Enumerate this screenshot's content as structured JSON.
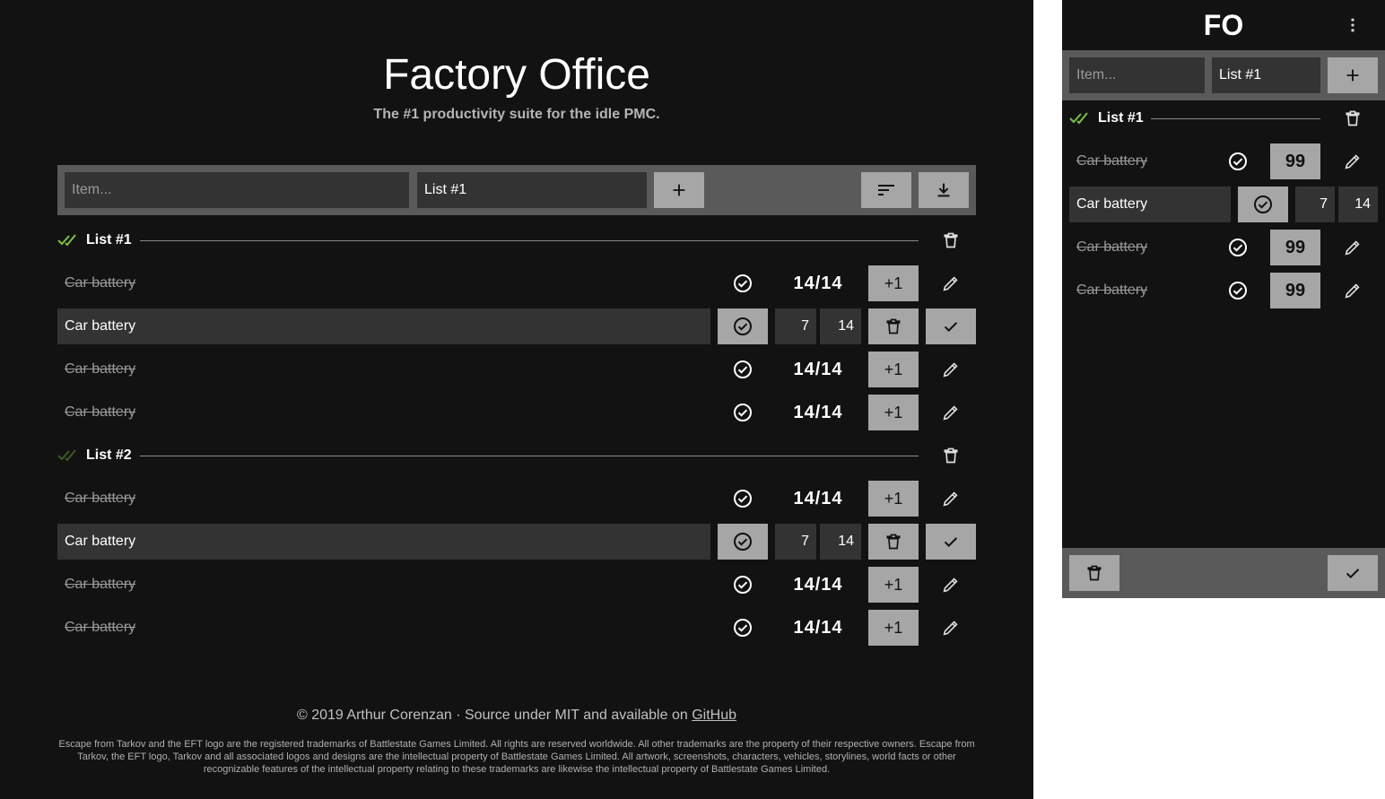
{
  "app": {
    "title": "Factory Office",
    "subtitle": "The #1 productivity suite for the idle PMC.",
    "short_title": "FO"
  },
  "toolbar": {
    "item_placeholder": "Item...",
    "list_value": "List #1",
    "add_icon": "plus-icon",
    "sort_icon": "sort-icon",
    "download_icon": "download-icon"
  },
  "lists": [
    {
      "name": "List #1",
      "status_icon": "double-check-icon",
      "status_color": "#7cc043",
      "items": [
        {
          "label": "Car battery",
          "mode": "view",
          "count": "14/14",
          "action": "+1"
        },
        {
          "label": "Car battery",
          "mode": "edit",
          "have": "7",
          "need": "14"
        },
        {
          "label": "Car battery",
          "mode": "view",
          "count": "14/14",
          "action": "+1"
        },
        {
          "label": "Car battery",
          "mode": "view",
          "count": "14/14",
          "action": "+1"
        }
      ]
    },
    {
      "name": "List #2",
      "status_icon": "double-check-icon",
      "status_color": "#3d5a25",
      "items": [
        {
          "label": "Car battery",
          "mode": "view",
          "count": "14/14",
          "action": "+1"
        },
        {
          "label": "Car battery",
          "mode": "edit",
          "have": "7",
          "need": "14"
        },
        {
          "label": "Car battery",
          "mode": "view",
          "count": "14/14",
          "action": "+1"
        },
        {
          "label": "Car battery",
          "mode": "view",
          "count": "14/14",
          "action": "+1"
        }
      ]
    }
  ],
  "footer": {
    "copyright": "© 2019 Arthur Corenzan · Source under MIT and available on",
    "link_text": "GitHub",
    "legal": "Escape from Tarkov and the EFT logo are the registered trademarks of Battlestate Games Limited. All rights are reserved worldwide. All other trademarks are the property of their respective owners. Escape from Tarkov, the EFT logo, Tarkov and all associated logos and designs are the intellectual property of Battlestate Games Limited. All artwork, screenshots, characters, vehicles, storylines, world facts or other recognizable features of the intellectual property relating to these trademarks are likewise the intellectual property of Battlestate Games Limited."
  },
  "mobile": {
    "item_placeholder": "Item...",
    "list_value": "List #1",
    "list_name": "List #1",
    "items": [
      {
        "label": "Car battery",
        "mode": "view",
        "qty": "99"
      },
      {
        "label": "Car battery",
        "mode": "edit",
        "have": "7",
        "need": "14"
      },
      {
        "label": "Car battery",
        "mode": "view",
        "qty": "99"
      },
      {
        "label": "Car battery",
        "mode": "view",
        "qty": "99"
      }
    ]
  },
  "colors": {
    "background": "#121212",
    "toolbar": "#5a5a5a",
    "field": "#333333",
    "button": "#a6a6a6",
    "accent": "#7cc043"
  }
}
